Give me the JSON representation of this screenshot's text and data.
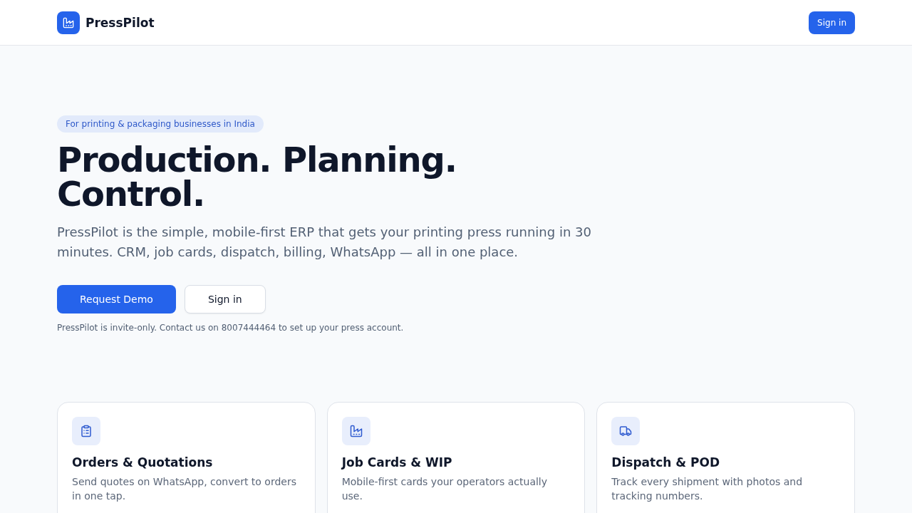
{
  "header": {
    "brand": "PressPilot",
    "sign_in": "Sign in"
  },
  "hero": {
    "badge": "For printing & packaging businesses in India",
    "title": "Production. Planning. Control.",
    "description": "PressPilot is the simple, mobile-first ERP that gets your printing press running in 30 minutes. CRM, job cards, dispatch, billing, WhatsApp — all in one place.",
    "buttons": [
      {
        "label": "Request Demo",
        "kind": "primary"
      },
      {
        "label": "Sign in",
        "kind": "secondary"
      }
    ],
    "note": "PressPilot is invite-only. Contact us on 8007444464 to set up your press account."
  },
  "features": [
    {
      "kind": "orders",
      "title": "Orders & Quotations",
      "description": "Send quotes on WhatsApp, convert to orders in one tap."
    },
    {
      "kind": "jobs",
      "title": "Job Cards & WIP",
      "description": "Mobile-first cards your operators actually use."
    },
    {
      "kind": "dispatch",
      "title": "Dispatch & POD",
      "description": "Track every shipment with photos and tracking numbers."
    }
  ]
}
